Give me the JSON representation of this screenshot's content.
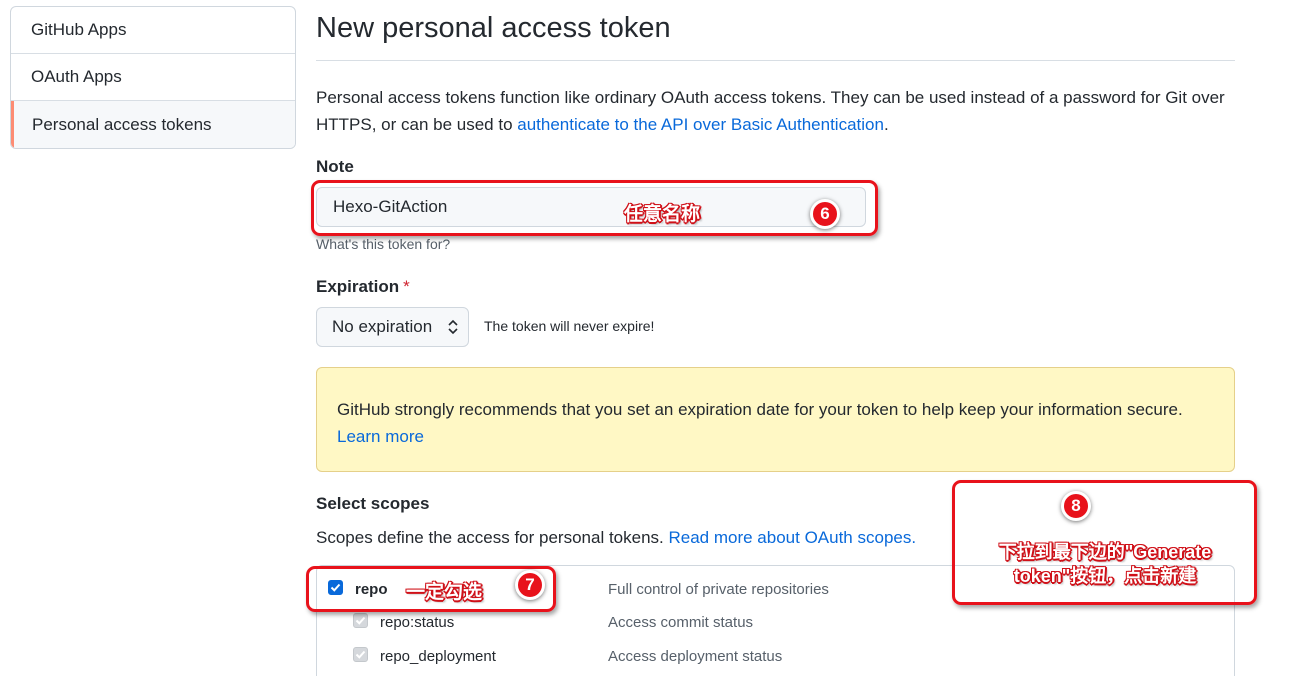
{
  "sidebar": {
    "items": [
      {
        "label": "GitHub Apps"
      },
      {
        "label": "OAuth Apps"
      },
      {
        "label": "Personal access tokens"
      }
    ]
  },
  "page": {
    "title": "New personal access token",
    "intro_text": "Personal access tokens function like ordinary OAuth access tokens. They can be used instead of a password for Git over HTTPS, or can be used to ",
    "intro_link": "authenticate to the API over Basic Authentication",
    "intro_end": "."
  },
  "note": {
    "label": "Note",
    "value": "Hexo-GitAction",
    "hint": "What's this token for?"
  },
  "expiration": {
    "label": "Expiration",
    "required_mark": "*",
    "selected": "No expiration",
    "note": "The token will never expire!"
  },
  "flash": {
    "text": "GitHub strongly recommends that you set an expiration date for your token to help keep your information secure. ",
    "link": "Learn more"
  },
  "scopes": {
    "label": "Select scopes",
    "desc": "Scopes define the access for personal tokens. ",
    "desc_link": "Read more about OAuth scopes.",
    "rows": [
      {
        "name": "repo",
        "desc": "Full control of private repositories"
      },
      {
        "name": "repo:status",
        "desc": "Access commit status"
      },
      {
        "name": "repo_deployment",
        "desc": "Access deployment status"
      }
    ]
  },
  "annotations": {
    "note_tip": "任意名称",
    "note_badge": "6",
    "repo_tip": "一定勾选",
    "repo_badge": "7",
    "generate_badge": "8",
    "generate_line1": "下拉到最下边的\"Generate",
    "generate_line2": "token\"按钮，点击新建",
    "color": "#e8121b"
  }
}
